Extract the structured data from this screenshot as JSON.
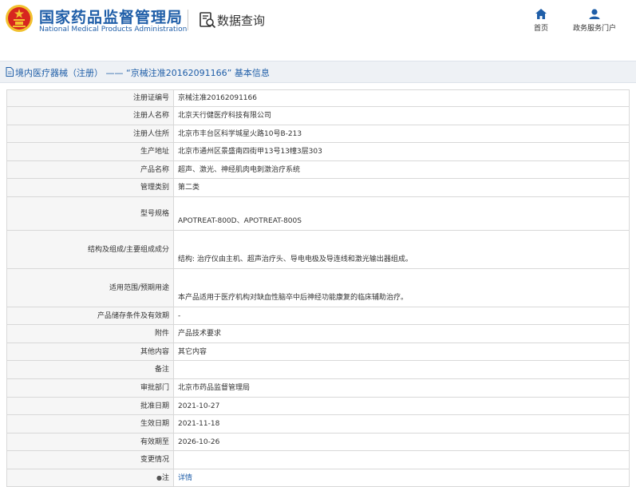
{
  "header": {
    "site_title": "国家药品监督管理局",
    "site_subtitle": "National Medical Products Administration",
    "query_title": "数据查询",
    "nav": [
      {
        "label": "首页",
        "icon": "home-icon"
      },
      {
        "label": "政务服务门户",
        "icon": "user-icon"
      }
    ]
  },
  "title_bar": {
    "text": "境内医疗器械（注册） —— “京械注准20162091166” 基本信息"
  },
  "rows": [
    {
      "label": "注册证编号",
      "value": "京械注准20162091166"
    },
    {
      "label": "注册人名称",
      "value": "北京天行健医疗科技有限公司"
    },
    {
      "label": "注册人住所",
      "value": "北京市丰台区科学城星火路10号B-213"
    },
    {
      "label": "生产地址",
      "value": "北京市通州区景盛南四街甲13号13幢3层303"
    },
    {
      "label": "产品名称",
      "value": "超声、激光、神经肌肉电刺激治疗系统"
    },
    {
      "label": "管理类别",
      "value": "第二类"
    },
    {
      "label": "型号规格",
      "value": "APOTREAT-800D、APOTREAT-800S"
    },
    {
      "label": "结构及组成/主要组成成分",
      "value": "结构: 治疗仪由主机、超声治疗头、导电电极及导连线和激光输出器组成。"
    },
    {
      "label": "适用范围/预期用途",
      "value": "本产品适用于医疗机构对缺血性脑卒中后神经功能康复的临床辅助治疗。"
    },
    {
      "label": "产品储存条件及有效期",
      "value": "-"
    },
    {
      "label": "附件",
      "value": "产品技术要求"
    },
    {
      "label": "其他内容",
      "value": "其它内容"
    },
    {
      "label": "备注",
      "value": ""
    },
    {
      "label": "审批部门",
      "value": "北京市药品监督管理局"
    },
    {
      "label": "批准日期",
      "value": "2021-10-27"
    },
    {
      "label": "生效日期",
      "value": "2021-11-18"
    },
    {
      "label": "有效期至",
      "value": "2026-10-26"
    },
    {
      "label": "变更情况",
      "value": ""
    },
    {
      "label": "注",
      "value": "详情",
      "label_icon": "bullet-icon"
    }
  ],
  "colors": {
    "brand_blue": "#1f5ea8",
    "emblem_red": "#d7261f",
    "emblem_gold": "#f2c230"
  }
}
